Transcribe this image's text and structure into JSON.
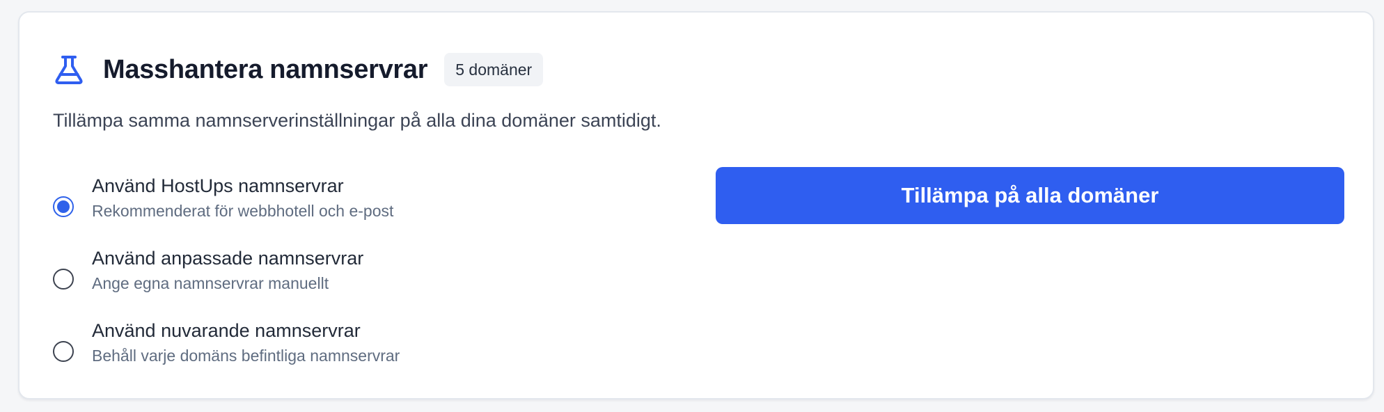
{
  "card": {
    "title": "Masshantera namnservrar",
    "badge": "5 domäner",
    "description": "Tillämpa samma namnserverinställningar på alla dina domäner samtidigt.",
    "icon": "flask-icon"
  },
  "options": [
    {
      "label": "Använd HostUps namnservrar",
      "sublabel": "Rekommenderat för webbhotell och e-post",
      "selected": true
    },
    {
      "label": "Använd anpassade namnservrar",
      "sublabel": "Ange egna namnservrar manuellt",
      "selected": false
    },
    {
      "label": "Använd nuvarande namnservrar",
      "sublabel": "Behåll varje domäns befintliga namnservrar",
      "selected": false
    }
  ],
  "apply_button": {
    "label": "Tillämpa på alla domäner"
  },
  "colors": {
    "accent": "#2f5ef0",
    "title": "#151b2c",
    "muted": "#5f6c80",
    "badge_bg": "#f1f3f6"
  }
}
